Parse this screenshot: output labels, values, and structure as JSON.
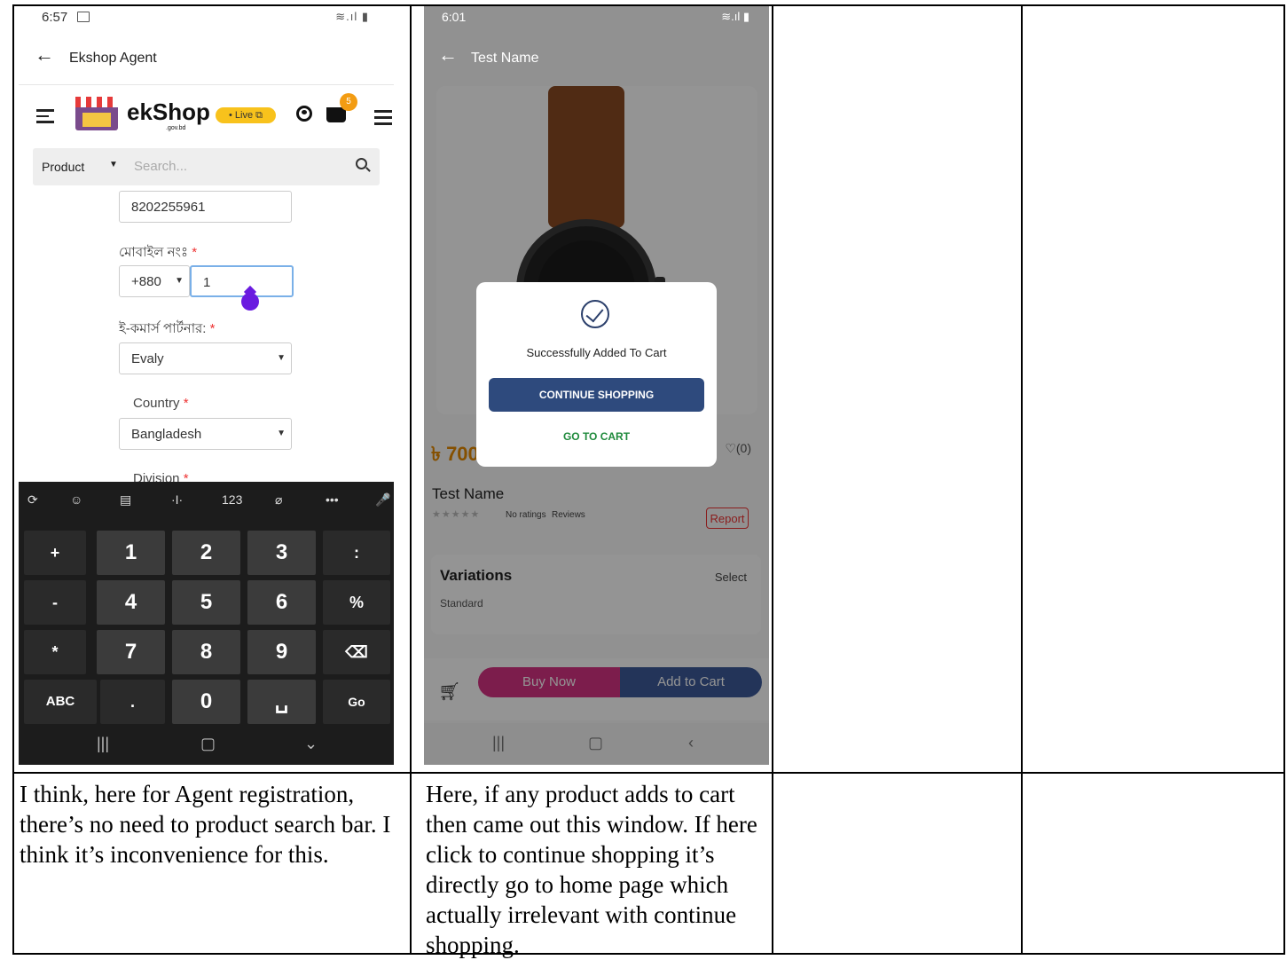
{
  "phone1": {
    "status": {
      "time": "6:57",
      "signal": "≋.ıl ▮"
    },
    "appbar": {
      "back": "←",
      "title": "Ekshop Agent"
    },
    "logo": {
      "text": "ekShop",
      "sub": ".gov.bd"
    },
    "live_badge": "• Live ⧉",
    "cart_count": "5",
    "search": {
      "category": "Product",
      "placeholder": "Search..."
    },
    "form": {
      "nid_value": "8202255961",
      "mobile_label": "মোবাইল নংঃ",
      "country_code": "+880",
      "mobile_value": "1",
      "partner_label": "ই-কমার্স পার্টনার:",
      "partner_value": "Evaly",
      "country_label": "Country",
      "country_value": "Bangladesh",
      "division_label": "Division",
      "required": "*"
    },
    "keyboard": {
      "toolbar": [
        "⟳",
        "☺",
        "▤",
        "·I·",
        "123",
        "⌀",
        "•••",
        "🎤"
      ],
      "keys": [
        "+",
        "1",
        "2",
        "3",
        ":",
        "-",
        "4",
        "5",
        "6",
        "%",
        "*",
        "7",
        "8",
        "9",
        "⌫",
        "ABC",
        ".",
        "0",
        "␣",
        "Go"
      ],
      "nav": [
        "|||",
        "▢",
        "⌄"
      ]
    }
  },
  "phone2": {
    "status": {
      "time": "6:01",
      "signal": "≋.ıl ▮"
    },
    "appbar": {
      "back": "←",
      "title": "Test Name"
    },
    "price": "৳ 700",
    "wishlist": "♡(0)",
    "product_name": "Test Name",
    "stars": "★★★★★",
    "ratings": "No ratings",
    "reviews": "Reviews",
    "report": "Report",
    "variations": {
      "title": "Variations",
      "select": "Select",
      "value": "Standard"
    },
    "buttons": {
      "buy_now": "Buy Now",
      "add_to_cart": "Add to Cart"
    },
    "nav": [
      "|||",
      "▢",
      "‹"
    ],
    "modal": {
      "message": "Successfully Added To Cart",
      "continue": "CONTINUE SHOPPING",
      "go_to_cart": "GO TO CART"
    }
  },
  "comments": {
    "col1": "I think, here for Agent registration, there’s no need to product search bar. I think it’s inconvenience for this.",
    "col2": "Here, if any product adds to cart then came out this window. If here click to continue shopping it’s directly go to home page which actually irrelevant with continue shopping."
  }
}
